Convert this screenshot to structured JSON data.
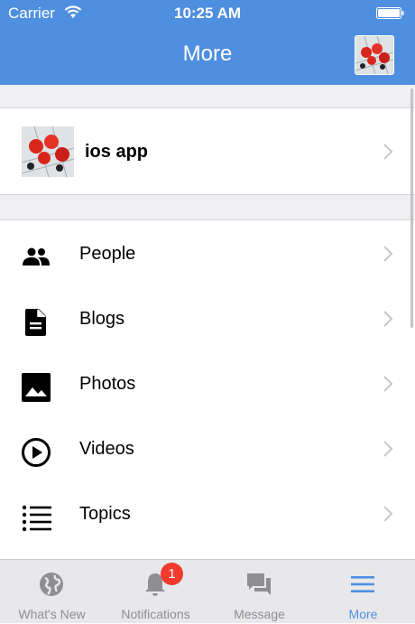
{
  "status_bar": {
    "carrier": "Carrier",
    "time": "10:25 AM"
  },
  "nav": {
    "title": "More"
  },
  "profile": {
    "name": "ios app"
  },
  "menu": {
    "items": [
      {
        "label": "People",
        "icon": "people-icon"
      },
      {
        "label": "Blogs",
        "icon": "document-icon"
      },
      {
        "label": "Photos",
        "icon": "photo-icon"
      },
      {
        "label": "Videos",
        "icon": "play-circle-icon"
      },
      {
        "label": "Topics",
        "icon": "list-icon"
      }
    ]
  },
  "tab_bar": {
    "tabs": [
      {
        "label": "What's New",
        "icon": "globe-icon"
      },
      {
        "label": "Notifications",
        "icon": "bell-icon",
        "badge": "1"
      },
      {
        "label": "Message",
        "icon": "chat-icon"
      },
      {
        "label": "More",
        "icon": "hamburger-menu-icon",
        "active": true
      }
    ]
  },
  "colors": {
    "accent": "#4f8fe0",
    "badge": "#f03a2e",
    "inactive": "#8e8e93"
  }
}
